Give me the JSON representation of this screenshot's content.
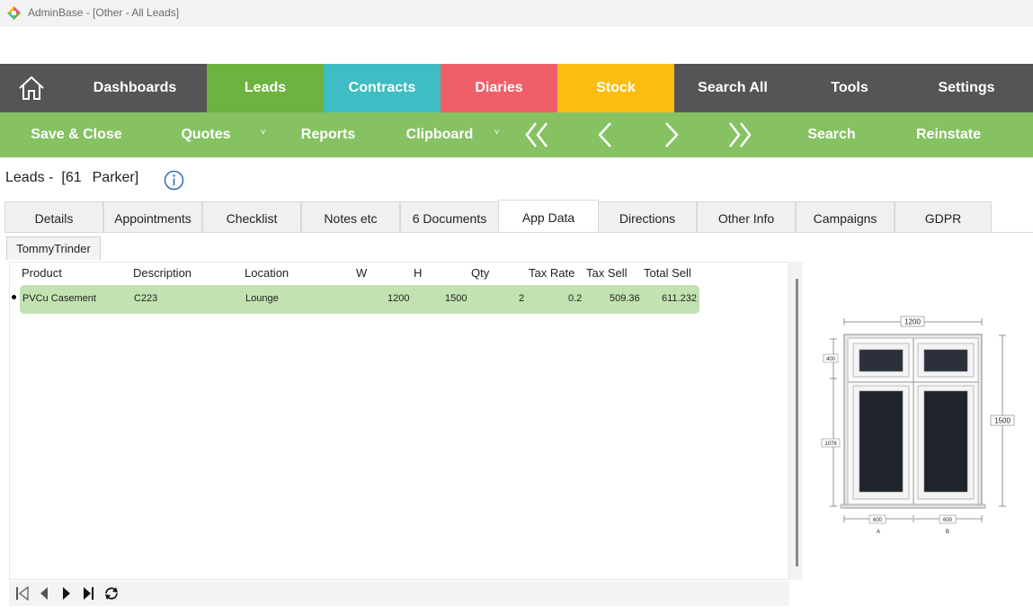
{
  "window": {
    "title": "AdminBase - [Other - All Leads]"
  },
  "topnav": {
    "home_icon": "home-icon",
    "items": [
      {
        "label": "Dashboards",
        "color": "#555555"
      },
      {
        "label": "Leads",
        "color": "#6db33f"
      },
      {
        "label": "Contracts",
        "color": "#3fbcc4"
      },
      {
        "label": "Diaries",
        "color": "#ee5f68"
      },
      {
        "label": "Stock",
        "color": "#fbbd12"
      },
      {
        "label": "Search All",
        "color": "#555555"
      },
      {
        "label": "Tools",
        "color": "#555555"
      },
      {
        "label": "Settings",
        "color": "#555555"
      }
    ]
  },
  "toolbar": {
    "save_close": "Save & Close",
    "quotes": "Quotes",
    "reports": "Reports",
    "clipboard": "Clipboard",
    "search": "Search",
    "reinstate": "Reinstate",
    "dropdown_caret": "˅",
    "nav_icons": [
      "double-chevron-left-icon",
      "chevron-left-icon",
      "chevron-right-icon",
      "double-chevron-right-icon"
    ]
  },
  "record": {
    "prefix": "Leads -",
    "ref": "[61",
    "name": "Parker]",
    "info_icon": "info-icon"
  },
  "tabs": [
    "Details",
    "Appointments",
    "Checklist",
    "Notes etc",
    "6 Documents",
    "App Data",
    "Directions",
    "Other Info",
    "Campaigns",
    "GDPR"
  ],
  "active_tab": "App Data",
  "subtab": "TommyTrinder",
  "table": {
    "columns": [
      "Product",
      "Description",
      "Location",
      "W",
      "H",
      "Qty",
      "Tax Rate",
      "Tax Sell",
      "Total Sell"
    ],
    "rows": [
      {
        "product": "PVCu Casement",
        "description": "C223",
        "location": "Lounge",
        "w": "1200",
        "h": "1500",
        "qty": "2",
        "tax_rate": "0.2",
        "tax_sell": "509.36",
        "total_sell": "611.232"
      }
    ]
  },
  "diagram": {
    "width": "1200",
    "height": "1500",
    "top_light": "400",
    "bottom_light": "1076",
    "pane_a": "600",
    "pane_b": "600",
    "label_a": "A",
    "label_b": "B"
  },
  "pager": {
    "icons": [
      "first-page-icon",
      "prev-page-icon",
      "next-page-icon",
      "last-page-icon",
      "refresh-icon"
    ]
  },
  "colors": {
    "nav_dark": "#555555",
    "toolbar_green": "#86c262",
    "row_highlight": "#c3e2b1",
    "pane_glass": "#22262f"
  }
}
